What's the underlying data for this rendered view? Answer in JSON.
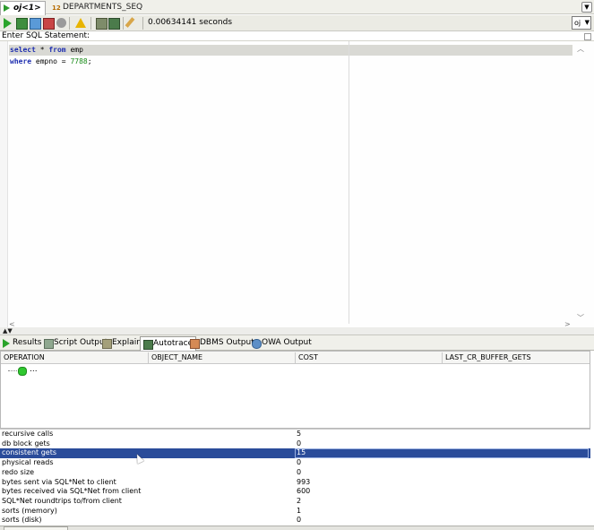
{
  "doc_tabs": [
    {
      "label": "oj<1>",
      "active": true
    },
    {
      "label": "DEPARTMENTS_SEQ",
      "icon_text": "12",
      "active": false
    }
  ],
  "toolbar": {
    "elapsed": "0.00634141 seconds",
    "connection": "oj"
  },
  "editor": {
    "label": "Enter SQL Statement:",
    "lines": [
      {
        "kw1": "select",
        "mid": " * ",
        "kw2": "from",
        "rest": " emp"
      },
      {
        "kw1": "where",
        "mid": " empno = ",
        "num": "7788",
        "rest": ";"
      }
    ]
  },
  "results_tabs": [
    {
      "label": "Results",
      "icon": "run-icon"
    },
    {
      "label": "Script Output",
      "icon": "script-icon"
    },
    {
      "label": "Explain",
      "icon": "explain-icon"
    },
    {
      "label": "Autotrace",
      "icon": "autotrace-icon",
      "active": true
    },
    {
      "label": "DBMS Output",
      "icon": "dbms-output-icon"
    },
    {
      "label": "OWA Output",
      "icon": "owa-output-icon"
    }
  ],
  "plan": {
    "columns": [
      "OPERATION",
      "OBJECT_NAME",
      "COST",
      "LAST_CR_BUFFER_GETS"
    ],
    "rows": [
      {
        "operation": "..."
      }
    ]
  },
  "stats": [
    {
      "name": "recursive calls",
      "value": "5"
    },
    {
      "name": "db block gets",
      "value": "0"
    },
    {
      "name": "consistent gets",
      "value": "15",
      "selected": true
    },
    {
      "name": "physical reads",
      "value": "0"
    },
    {
      "name": "redo size",
      "value": "0"
    },
    {
      "name": "bytes sent via SQL*Net to client",
      "value": "993"
    },
    {
      "name": "bytes received via SQL*Net from client",
      "value": "600"
    },
    {
      "name": "SQL*Net roundtrips to/from client",
      "value": "2"
    },
    {
      "name": "sorts (memory)",
      "value": "1"
    },
    {
      "name": "sorts (disk)",
      "value": "0"
    }
  ],
  "colors": {
    "selection": "#2a4c9a",
    "keyword": "#1f2fb0",
    "number": "#1a8c1a"
  }
}
